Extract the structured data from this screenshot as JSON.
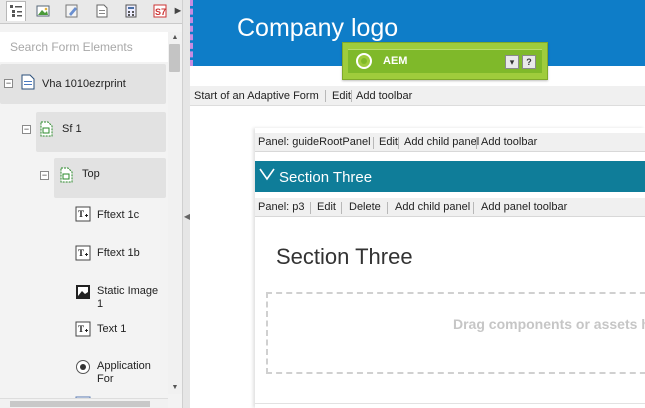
{
  "sidebar": {
    "tabs": [
      {
        "icon": "tree-icon",
        "active": true
      },
      {
        "icon": "image-icon",
        "active": false
      },
      {
        "icon": "brush-icon",
        "active": false
      },
      {
        "icon": "page-icon",
        "active": false
      },
      {
        "icon": "calculator-icon",
        "active": false
      },
      {
        "icon": "s7-icon",
        "active": false,
        "text": "S7"
      }
    ],
    "more_arrow": "►",
    "search_placeholder": "Search Form Elements",
    "tree": [
      {
        "label": "Vha 1010ezrprint",
        "icon": "form-icon",
        "toggle": "−"
      },
      {
        "label": "Sf 1",
        "icon": "panel-icon",
        "toggle": "−"
      },
      {
        "label": "Top",
        "icon": "panel-icon",
        "toggle": "−"
      },
      {
        "label": "Fftext 1c",
        "icon": "text-field-icon"
      },
      {
        "label": "Fftext 1b",
        "icon": "text-field-icon"
      },
      {
        "label": "Static Image 1",
        "icon": "image-icon"
      },
      {
        "label": "Text 1",
        "icon": "text-field-icon"
      },
      {
        "label": "Application For",
        "icon": "radio-icon"
      }
    ]
  },
  "header": {
    "logo_text": "Company logo"
  },
  "aem": {
    "label": "AEM",
    "dropdown_symbol": "▾",
    "help_symbol": "?"
  },
  "toolbar": {
    "title": "Start of an Adaptive Form",
    "items": [
      "Edit",
      "Add toolbar"
    ]
  },
  "panel1": {
    "title": "Panel: guideRootPanel",
    "items": [
      "Edit",
      "Add child panel",
      "Add toolbar"
    ]
  },
  "section": {
    "chevron": "╲╱",
    "heading": "Section Three"
  },
  "panel2": {
    "title": "Panel: p3",
    "items": [
      "Edit",
      "Delete",
      "Add child panel",
      "Add panel toolbar"
    ]
  },
  "content": {
    "title": "Section Three",
    "drop_text": "Drag components or assets here"
  },
  "colors": {
    "header": "#0e7dc8",
    "section": "#0f7d99",
    "aem": "#9fcc3c"
  }
}
